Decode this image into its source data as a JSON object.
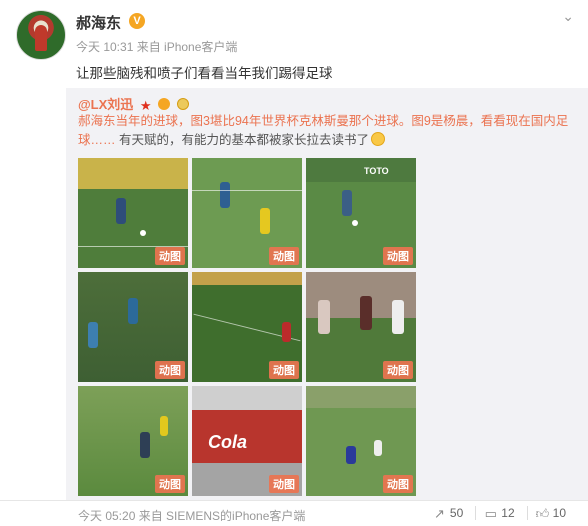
{
  "post": {
    "username": "郝海东",
    "verified_mark": "V",
    "meta": "今天 10:31 来自 iPhone客户端",
    "text": "让那些脑残和喷子们看看当年我们踢得足球"
  },
  "repost": {
    "user": "@LX刘迅",
    "text_part1": "郝海东当年的进球，图3堪比94年世界杯克林斯曼那个进球。图9是杨晨，看看现在国内足球……",
    "text_part2": " 有天赋的，有能力的基本都被家长拉去读书了",
    "gif_label": "动图",
    "images": [
      {
        "name": "gif-thumb-1"
      },
      {
        "name": "gif-thumb-2"
      },
      {
        "name": "gif-thumb-3"
      },
      {
        "name": "gif-thumb-4"
      },
      {
        "name": "gif-thumb-5"
      },
      {
        "name": "gif-thumb-6"
      },
      {
        "name": "gif-thumb-7"
      },
      {
        "name": "gif-thumb-8"
      },
      {
        "name": "gif-thumb-9"
      }
    ],
    "footer_meta": "今天 05:20 来自 SIEMENS的iPhone客户端",
    "actions": {
      "repost_count": "50",
      "comment_count": "12",
      "like_count": "10"
    },
    "sign_text_c3": "TOTO",
    "sign_text_c8": "Cola"
  },
  "icons": {
    "chevron": "chevron-down-icon",
    "repost": "repost-icon",
    "comment": "comment-icon",
    "like": "like-icon"
  }
}
